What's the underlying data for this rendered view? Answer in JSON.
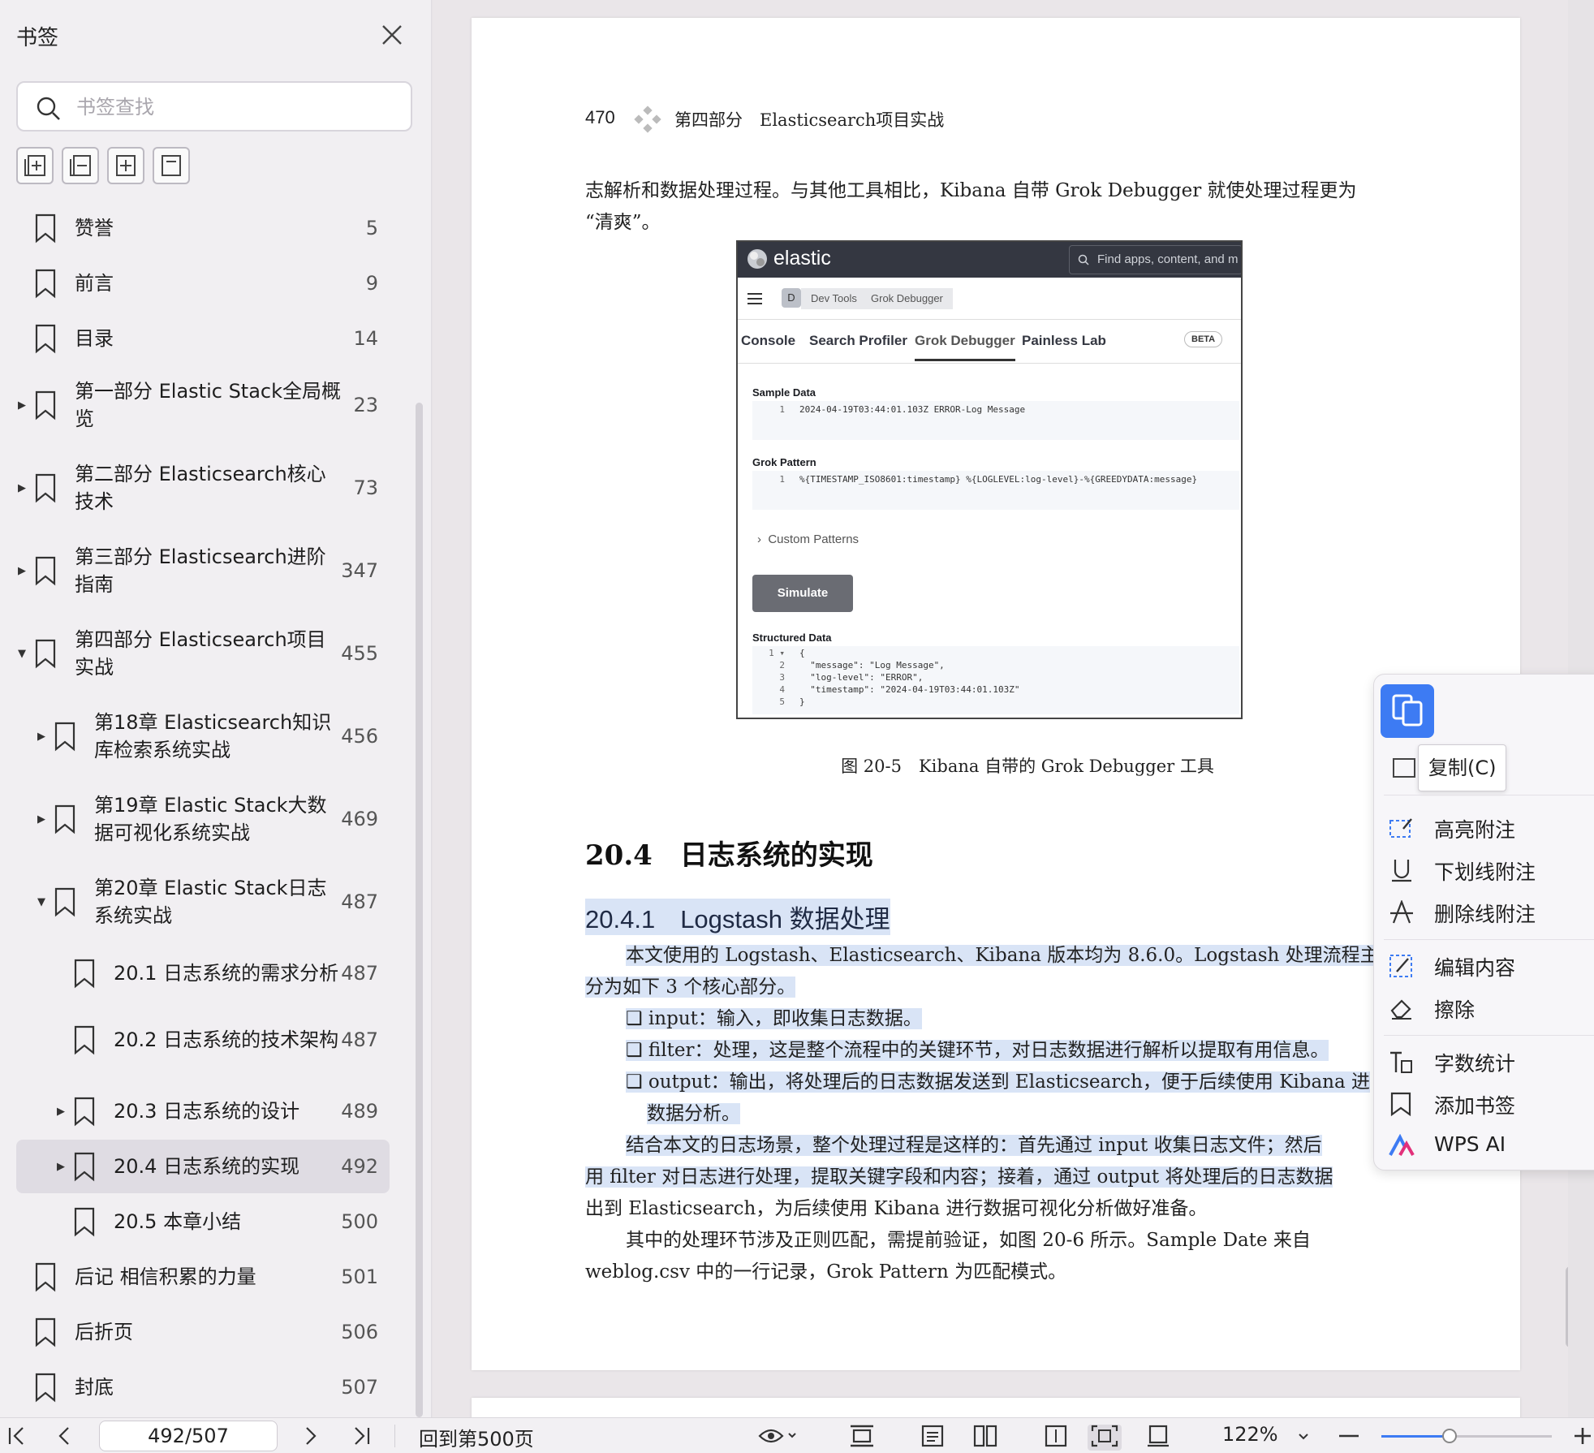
{
  "sidebar": {
    "title": "书签",
    "search_placeholder": "书签查找",
    "bookmarks": [
      {
        "label": "赞誉",
        "page": "5"
      },
      {
        "label": "前言",
        "page": "9"
      },
      {
        "label": "目录",
        "page": "14"
      },
      {
        "label": "第一部分 Elastic Stack全局概览",
        "page": "23",
        "expand": "collapsed"
      },
      {
        "label": "第二部分 Elasticsearch核心技术",
        "page": "73",
        "expand": "collapsed"
      },
      {
        "label": "第三部分 Elasticsearch进阶指南",
        "page": "347",
        "expand": "collapsed"
      },
      {
        "label": "第四部分 Elasticsearch项目实战",
        "page": "455",
        "expand": "expanded"
      },
      {
        "label": "第18章 Elasticsearch知识库检索系统实战",
        "page": "456",
        "expand": "collapsed"
      },
      {
        "label": "第19章 Elastic Stack大数据可视化系统实战",
        "page": "469",
        "expand": "collapsed"
      },
      {
        "label": "第20章 Elastic Stack日志系统实战",
        "page": "487",
        "expand": "expanded"
      },
      {
        "label": "20.1 日志系统的需求分析",
        "page": "487"
      },
      {
        "label": "20.2 日志系统的技术架构",
        "page": "487"
      },
      {
        "label": "20.3 日志系统的设计",
        "page": "489",
        "expand": "collapsed"
      },
      {
        "label": "20.4 日志系统的实现",
        "page": "492",
        "expand": "collapsed",
        "selected": true
      },
      {
        "label": "20.5 本章小结",
        "page": "500"
      },
      {
        "label": "后记 相信积累的力量",
        "page": "501"
      },
      {
        "label": "后折页",
        "page": "506"
      },
      {
        "label": "封底",
        "page": "507"
      }
    ]
  },
  "page": {
    "header_num": "470",
    "header_text": "第四部分　Elasticsearch项目实战",
    "intro_line1": "志解析和数据处理过程。与其他工具相比，Kibana 自带 Grok Debugger 就使处理过程更为",
    "intro_line2": "“清爽”。",
    "figure": {
      "brand": "elastic",
      "search": "Find apps, content, and m",
      "space": "D",
      "crumb1": "Dev Tools",
      "crumb2": "Grok Debugger",
      "tabs": [
        "Console",
        "Search Profiler",
        "Grok Debugger",
        "Painless Lab"
      ],
      "beta": "BETA",
      "sample_label": "Sample Data",
      "sample_code": "2024-04-19T03:44:01.103Z ERROR-Log Message",
      "pattern_label": "Grok Pattern",
      "pattern_code": "%{TIMESTAMP_ISO8601:timestamp} %{LOGLEVEL:log-level}-%{GREEDYDATA:message}",
      "custom_patterns": "Custom Patterns",
      "simulate": "Simulate",
      "structured_label": "Structured Data",
      "structured_lines": [
        "{",
        "  \"message\": \"Log Message\",",
        "  \"log-level\": \"ERROR\",",
        "  \"timestamp\": \"2024-04-19T03:44:01.103Z\"",
        "}"
      ],
      "caption": "图 20-5　Kibana 自带的 Grok Debugger 工具"
    },
    "h2": "20.4　日志系统的实现",
    "h3": "20.4.1　Logstash 数据处理",
    "p1_line1": "本文使用的 Logstash、Elasticsearch、Kibana 版本均为 8.6.0。Logstash 处理流程主",
    "p1_line2": "分为如下 3 个核心部分。",
    "bullet1": "❑ input：输入，即收集日志数据。",
    "bullet2": "❑ filter：处理，这是整个流程中的关键环节，对日志数据进行解析以提取有用信息。",
    "bullet3_line1": "❑ output：输出，将处理后的日志数据发送到 Elasticsearch，便于后续使用 Kibana 进",
    "bullet3_line2": "数据分析。",
    "p2_line1": "结合本文的日志场景，整个处理过程是这样的：首先通过 input 收集日志文件；然后",
    "p2_line2": "用 filter 对日志进行处理，提取关键字段和内容；接着，通过 output 将处理后的日志数据",
    "p2_line3": "出到 Elasticsearch，为后续使用 Kibana 进行数据可视化分析做好准备。",
    "p3_line1": "其中的处理环节涉及正则匹配，需提前验证，如图 20-6 所示。Sample Date 来自",
    "p3_line2": "weblog.csv 中的一行记录，Grok Pattern 为匹配模式。"
  },
  "context_menu": {
    "tooltip": "复制(C)",
    "items": [
      "高亮附注",
      "下划线附注",
      "删除线附注",
      "编辑内容",
      "擦除",
      "字数统计",
      "添加书签",
      "WPS AI"
    ]
  },
  "statusbar": {
    "page_value": "492/507",
    "back_label": "回到第500页",
    "zoom": "122%",
    "zoom_fraction": 0.4
  }
}
